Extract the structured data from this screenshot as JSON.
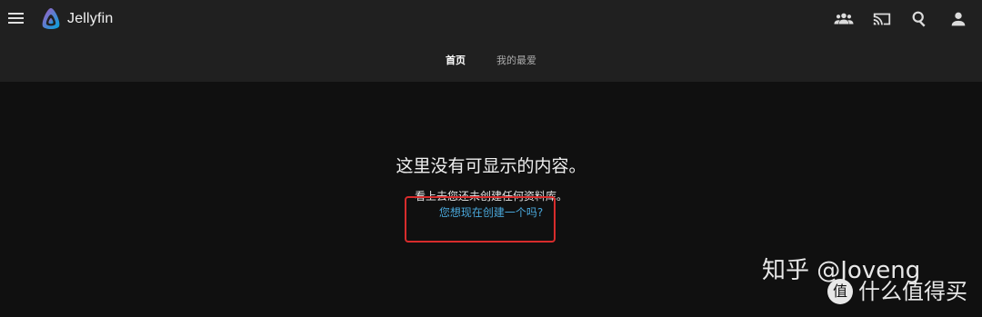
{
  "app": {
    "title": "Jellyfin"
  },
  "header": {
    "icons": [
      "menu-icon",
      "users-icon",
      "cast-icon",
      "search-icon",
      "user-icon"
    ]
  },
  "tabs": [
    {
      "label": "首页",
      "active": true
    },
    {
      "label": "我的最爱",
      "active": false
    }
  ],
  "empty_state": {
    "title": "这里没有可显示的内容。",
    "message": "看上去您还未创建任何资料库。",
    "link": "您想现在创建一个吗?"
  },
  "annotation": {
    "highlight_color": "#d72c2c"
  },
  "watermark": {
    "line1": "知乎 @Joveng",
    "badge": "值",
    "line2": "什么值得买"
  },
  "colors": {
    "background": "#101010",
    "header": "#202020",
    "link": "#4aa7da"
  }
}
